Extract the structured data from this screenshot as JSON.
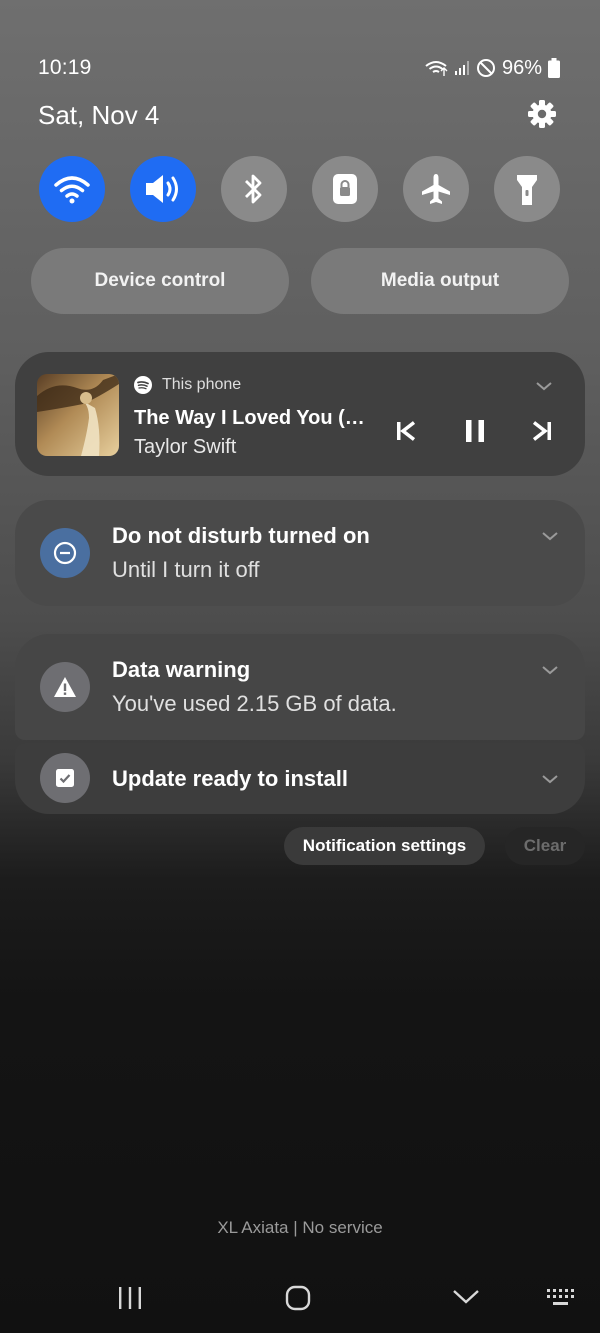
{
  "status_bar": {
    "time": "10:19",
    "battery": "96%"
  },
  "header": {
    "date": "Sat, Nov 4"
  },
  "quick_settings": [
    {
      "name": "wifi",
      "active": true
    },
    {
      "name": "sound",
      "active": true
    },
    {
      "name": "bluetooth",
      "active": false
    },
    {
      "name": "portrait-lock",
      "active": false
    },
    {
      "name": "airplane-mode",
      "active": false
    },
    {
      "name": "flashlight",
      "active": false
    }
  ],
  "panel_buttons": {
    "device_control": "Device control",
    "media_output": "Media output"
  },
  "media": {
    "source": "This phone",
    "title": "The Way I Loved You (…",
    "artist": "Taylor Swift"
  },
  "notifications": {
    "dnd": {
      "title": "Do not disturb turned on",
      "subtitle": "Until I turn it off"
    },
    "data_warning": {
      "title": "Data warning",
      "subtitle": "You've used 2.15 GB of data."
    },
    "update": {
      "title": "Update ready to install"
    }
  },
  "actions": {
    "notification_settings": "Notification settings",
    "clear": "Clear"
  },
  "footer": {
    "carrier": "XL Axiata | No service"
  },
  "colors": {
    "accent": "#1f6cf3",
    "tile_off": "#8a8a8a",
    "dnd_icon": "#4a6fa0"
  }
}
